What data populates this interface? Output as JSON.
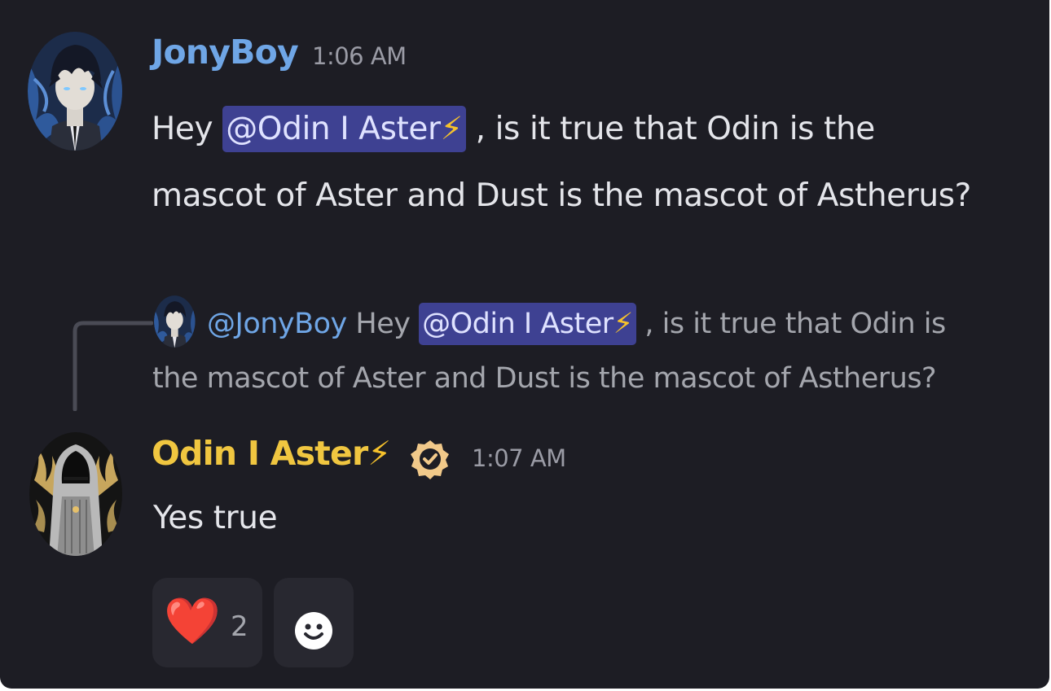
{
  "message1": {
    "username": "JonyBoy",
    "timestamp": "1:06 AM",
    "text_pre": "Hey ",
    "mention": "@Odin I Aster",
    "mention_emoji": "⚡",
    "text_post_line1": " , is it true that Odin is the",
    "text_line2": "mascot of Aster and Dust is the mascot of Astherus?",
    "avatar_icon": "anime-boy-avatar-icon"
  },
  "reply": {
    "username": "@JonyBoy",
    "text_pre": " Hey ",
    "mention": "@Odin I Aster",
    "mention_emoji": "⚡",
    "text_post_line1": " , is it true that Odin is",
    "text_line2": "the mascot of Aster and Dust is the mascot of Astherus?"
  },
  "message2": {
    "username": "Odin I Aster",
    "username_emoji": "⚡",
    "badge_icon": "verified-badge-icon",
    "timestamp": "1:07 AM",
    "text": "Yes true",
    "avatar_icon": "hooded-figure-avatar-icon"
  },
  "reactions": [
    {
      "emoji": "❤️",
      "icon": "heart-icon",
      "count": "2"
    },
    {
      "icon": "add-reaction-icon"
    }
  ],
  "colors": {
    "background": "#1d1d24",
    "username1": "#6fa6e6",
    "username2": "#f0c640",
    "mention_bg": "#3e4192",
    "text": "#e4e5ea",
    "timestamp": "#9a9ba5"
  }
}
